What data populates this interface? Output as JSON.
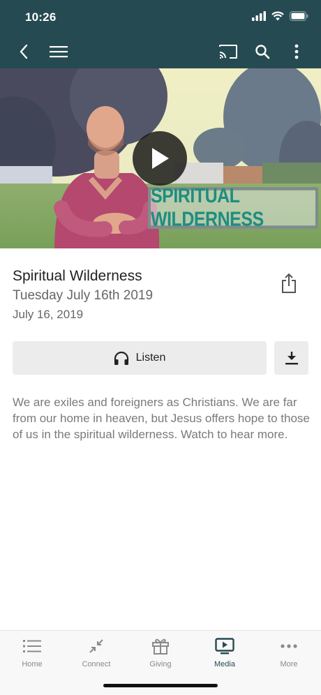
{
  "status_bar": {
    "time": "10:26"
  },
  "nav": {
    "back": "back-icon",
    "menu": "hamburger-menu-icon",
    "cast": "cast-icon",
    "search": "search-icon",
    "more": "more-vertical-icon"
  },
  "video": {
    "overlay_text": "SPIRITUAL WILDERNESS",
    "play": "play-icon"
  },
  "content": {
    "title": "Spiritual Wilderness",
    "subtitle": "Tuesday July 16th 2019",
    "date": "July 16, 2019",
    "listen_label": "Listen",
    "description": "We are exiles and foreigners as Christians.  We are far from our home in heaven, but Jesus offers hope to those of us in the spiritual wilderness.  Watch to hear more."
  },
  "tabs": [
    {
      "label": "Home",
      "icon": "list-icon",
      "active": false
    },
    {
      "label": "Connect",
      "icon": "connect-arrows-icon",
      "active": false
    },
    {
      "label": "Giving",
      "icon": "gift-icon",
      "active": false
    },
    {
      "label": "Media",
      "icon": "media-play-icon",
      "active": true
    },
    {
      "label": "More",
      "icon": "more-dots-icon",
      "active": false
    }
  ],
  "colors": {
    "header": "#264a51",
    "accent": "#264a51",
    "overlay_text": "#1f8d80"
  }
}
